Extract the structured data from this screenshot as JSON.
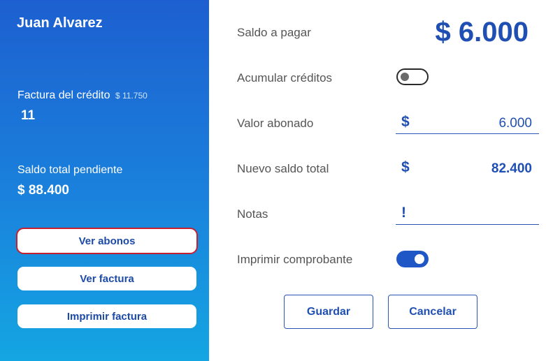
{
  "sidebar": {
    "customer_name": "Juan Alvarez",
    "invoice_label": "Factura del crédito",
    "invoice_amount": "$ 11.750",
    "invoice_number": "11",
    "pending_label": "Saldo total pendiente",
    "pending_value": "$ 88.400",
    "buttons": {
      "ver_abonos": "Ver abonos",
      "ver_factura": "Ver factura",
      "imprimir_factura": "Imprimir factura"
    },
    "selected_button": "ver_abonos"
  },
  "form": {
    "saldo_label": "Saldo a pagar",
    "saldo_value": "$ 6.000",
    "acumular_label": "Acumular créditos",
    "acumular_on": false,
    "valor_label": "Valor abonado",
    "valor_prefix": "$",
    "valor_value": "6.000",
    "nuevo_label": "Nuevo saldo total",
    "nuevo_prefix": "$",
    "nuevo_value": "82.400",
    "notas_label": "Notas",
    "notas_value": "!",
    "imprimir_label": "Imprimir comprobante",
    "imprimir_on": true
  },
  "actions": {
    "guardar": "Guardar",
    "cancelar": "Cancelar"
  },
  "colors": {
    "sidebar_top": "#1d5fd0",
    "sidebar_bottom": "#14a6e2",
    "accent": "#1f4fb3",
    "selected_outline": "#c62030"
  }
}
